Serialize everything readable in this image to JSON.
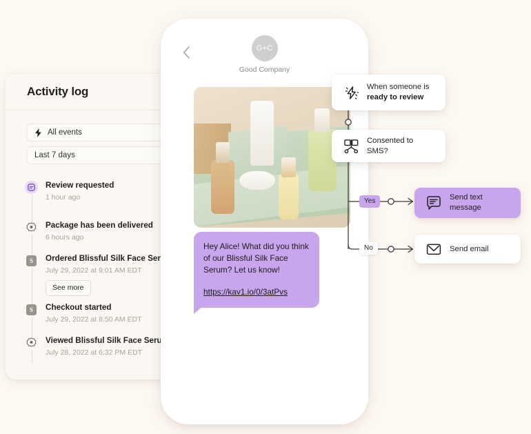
{
  "theme": {
    "background": "#FDF8F2",
    "accent_purple": "#C7A6ED",
    "panel_bg": "#FBF8F4",
    "card_white": "#FFFFFF",
    "muted_text": "#A9A29B"
  },
  "activity_log": {
    "title": "Activity log",
    "filters": [
      {
        "label": "All events",
        "icon": "bolt-icon",
        "has_icon": true
      },
      {
        "label": "Last 7 days",
        "icon": "",
        "has_icon": false
      }
    ],
    "events": [
      {
        "title": "Review requested",
        "time": "1 hour ago",
        "icon": "review-badge-icon",
        "icon_type": "purple-badge",
        "see_more": null
      },
      {
        "title": "Package has been delivered",
        "time": "6 hours ago",
        "icon": "gear-dot-icon",
        "icon_type": "gear",
        "see_more": null
      },
      {
        "title": "Ordered Blissful Silk Face Serum",
        "time": "July 29, 2022 at 9:01 AM EDT",
        "icon": "shopify-bag-icon",
        "icon_type": "shopify",
        "see_more": "See more"
      },
      {
        "title": "Checkout started",
        "time": "July 29, 2022 at 8:50 AM EDT",
        "icon": "shopify-bag-icon",
        "icon_type": "shopify",
        "see_more": null
      },
      {
        "title": "Viewed Blissful Silk Face Serum",
        "time": "July 28, 2022 at 6:32 PM EDT",
        "icon": "gear-dot-icon",
        "icon_type": "gear",
        "see_more": null
      }
    ]
  },
  "phone": {
    "back_icon": "chevron-left-icon",
    "avatar_initials": "G+C",
    "company_name": "Good Company",
    "product_image_alt": "skincare-serum-bottles-photo",
    "message": {
      "body": "Hey Alice! What did you think of our Blissful Silk Face Serum? Let us know!",
      "link": "https://kav1.io/0/3atPvs"
    }
  },
  "flow": {
    "trigger": {
      "icon": "lightning-bolt-icon",
      "line1": "When someone is",
      "line2": "ready to review"
    },
    "condition": {
      "icon": "branch-split-icon",
      "label": "Consented to SMS?"
    },
    "branches": [
      {
        "chip": "Yes",
        "chip_style": "purple"
      },
      {
        "chip": "No",
        "chip_style": "white"
      }
    ],
    "actions": [
      {
        "icon": "chat-message-icon",
        "label": "Send text message",
        "style": "purple"
      },
      {
        "icon": "envelope-icon",
        "label": "Send email",
        "style": "white"
      }
    ]
  }
}
